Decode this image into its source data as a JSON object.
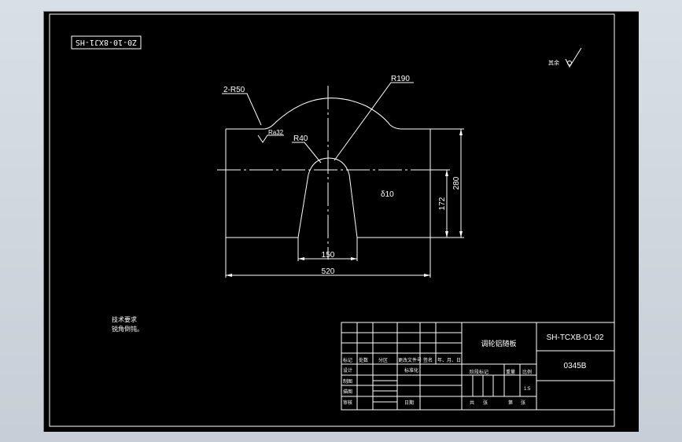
{
  "drawing": {
    "code_box": "Z0-10-8XJ1-HS",
    "roughness_corner": "其余",
    "dimensions": {
      "fillet_r50": "2-R50",
      "radius_r190": "R190",
      "radius_r40": "R40",
      "surface_finish": "Ra32",
      "thickness": "δ10",
      "bottom_width": "150",
      "total_width": "520",
      "height_280": "280",
      "height_172": "172"
    }
  },
  "notes": {
    "title": "技术要求",
    "line1": "锐角倒钝。"
  },
  "title_block": {
    "part_name": "调轮铝随板",
    "drawing_number": "SH-TCXB-01-02",
    "material_code": "0345B",
    "headers": [
      "标记",
      "处数",
      "分区",
      "更改文件号",
      "签名",
      "年、月、日"
    ],
    "roles": [
      "设计",
      "制图",
      "描图",
      "审核"
    ],
    "role2": [
      "标准化",
      "",
      "",
      "日期"
    ],
    "stage_label": "阶段标记",
    "weight_label": "重量",
    "scale_label": "比例",
    "scale_value": "1:5",
    "sheets_label": "共",
    "sheet_label": "张",
    "page_label": "第"
  }
}
